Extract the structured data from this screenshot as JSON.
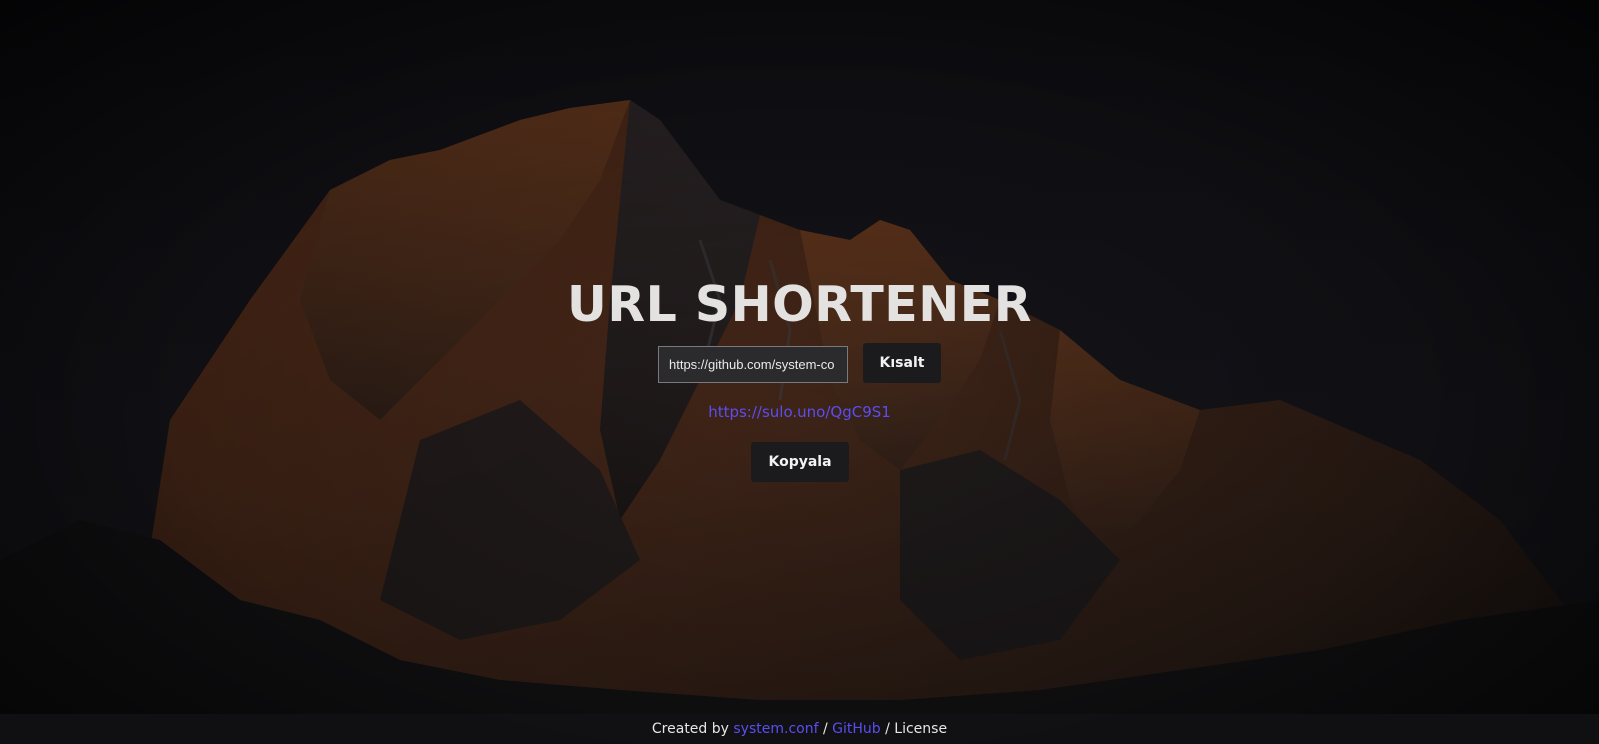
{
  "header": {
    "title": "URL SHORTENER"
  },
  "form": {
    "url_value": "https://github.com/system-co",
    "shorten_label": "Kısalt"
  },
  "result": {
    "short_url": "https://sulo.uno/QgC9S1",
    "copy_label": "Kopyala"
  },
  "footer": {
    "prefix": "Created by",
    "author_link": "system.conf",
    "sep1": "/",
    "github_link": "GitHub",
    "sep2": "/",
    "license_text": "License"
  },
  "colors": {
    "accent": "#5b4df2",
    "title": "#e4e1e1",
    "button_bg": "#1b1b1d",
    "mountain_highlight": "#7a3f1f"
  }
}
